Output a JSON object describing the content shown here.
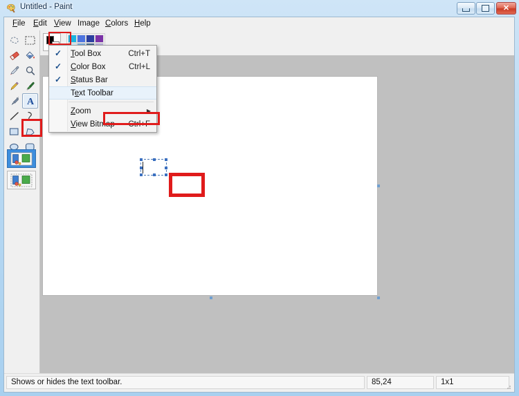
{
  "window": {
    "title": "Untitled - Paint",
    "icon": "paint-palette-icon",
    "buttons": {
      "minimize": "Minimize",
      "maximize": "Maximize",
      "close": "Close"
    }
  },
  "menubar": {
    "items": [
      {
        "label": "File",
        "accesskey": "F",
        "active": false
      },
      {
        "label": "Edit",
        "accesskey": "E",
        "active": false
      },
      {
        "label": "View",
        "accesskey": "V",
        "active": true
      },
      {
        "label": "Image",
        "accesskey": "g",
        "active": false
      },
      {
        "label": "Colors",
        "accesskey": "C",
        "active": false
      },
      {
        "label": "Help",
        "accesskey": "H",
        "active": false
      }
    ]
  },
  "view_menu": {
    "items": [
      {
        "label": "Tool Box",
        "accel": "Ctrl+T",
        "checked": true,
        "hover": false,
        "submenu": false
      },
      {
        "label": "Color Box",
        "accel": "Ctrl+L",
        "checked": true,
        "hover": false,
        "submenu": false
      },
      {
        "label": "Status Bar",
        "accel": "",
        "checked": true,
        "hover": false,
        "submenu": false
      },
      {
        "label": "Text Toolbar",
        "accel": "",
        "checked": false,
        "hover": true,
        "submenu": false
      },
      {
        "label": "Zoom",
        "accel": "",
        "checked": false,
        "hover": false,
        "submenu": true
      },
      {
        "label": "View Bitmap",
        "accel": "Ctrl+F",
        "checked": false,
        "hover": false,
        "submenu": false
      }
    ],
    "check_glyph": "✓",
    "submenu_glyph": "▶"
  },
  "toolbox": {
    "tools": [
      {
        "name": "free-form-select-tool",
        "selected": false
      },
      {
        "name": "rectangle-select-tool",
        "selected": false
      },
      {
        "name": "eraser-tool",
        "selected": false
      },
      {
        "name": "fill-tool",
        "selected": false
      },
      {
        "name": "color-picker-tool",
        "selected": false
      },
      {
        "name": "magnifier-tool",
        "selected": false
      },
      {
        "name": "pencil-tool",
        "selected": false
      },
      {
        "name": "brush-tool",
        "selected": false
      },
      {
        "name": "airbrush-tool",
        "selected": false
      },
      {
        "name": "text-tool",
        "selected": true
      },
      {
        "name": "line-tool",
        "selected": false
      },
      {
        "name": "curve-tool",
        "selected": false
      },
      {
        "name": "rectangle-tool",
        "selected": false
      },
      {
        "name": "polygon-tool",
        "selected": false
      },
      {
        "name": "ellipse-tool",
        "selected": false
      },
      {
        "name": "rounded-rectangle-tool",
        "selected": false
      }
    ],
    "options": [
      {
        "name": "draw-opaque-option",
        "selected": true
      },
      {
        "name": "draw-transparent-option",
        "selected": false
      }
    ]
  },
  "palette": {
    "foreground_color": "#000000",
    "background_color": "#ffffff",
    "swatches_row1": [
      "#18b4e0",
      "#4d74e0",
      "#2b3fa0",
      "#7b32a8"
    ],
    "swatches_row2": [
      "#c8eaf8",
      "#76a8d8",
      "#4a6e8c",
      "#b5b0d8"
    ]
  },
  "canvas": {
    "selection": {
      "name": "text-entry-box",
      "caret_visible": true
    }
  },
  "statusbar": {
    "message": "Shows or hides the text toolbar.",
    "cursor_position": "85,24",
    "selection_size": "1x1"
  },
  "annotations": {
    "accent_color": "#e01b1b",
    "boxes": [
      {
        "name": "view-menu-highlight",
        "target": "View menu"
      },
      {
        "name": "text-toolbar-highlight",
        "target": "Text Toolbar menu item"
      },
      {
        "name": "text-tool-highlight",
        "target": "Text tool button"
      },
      {
        "name": "text-box-highlight",
        "target": "Text entry box on canvas"
      }
    ]
  }
}
